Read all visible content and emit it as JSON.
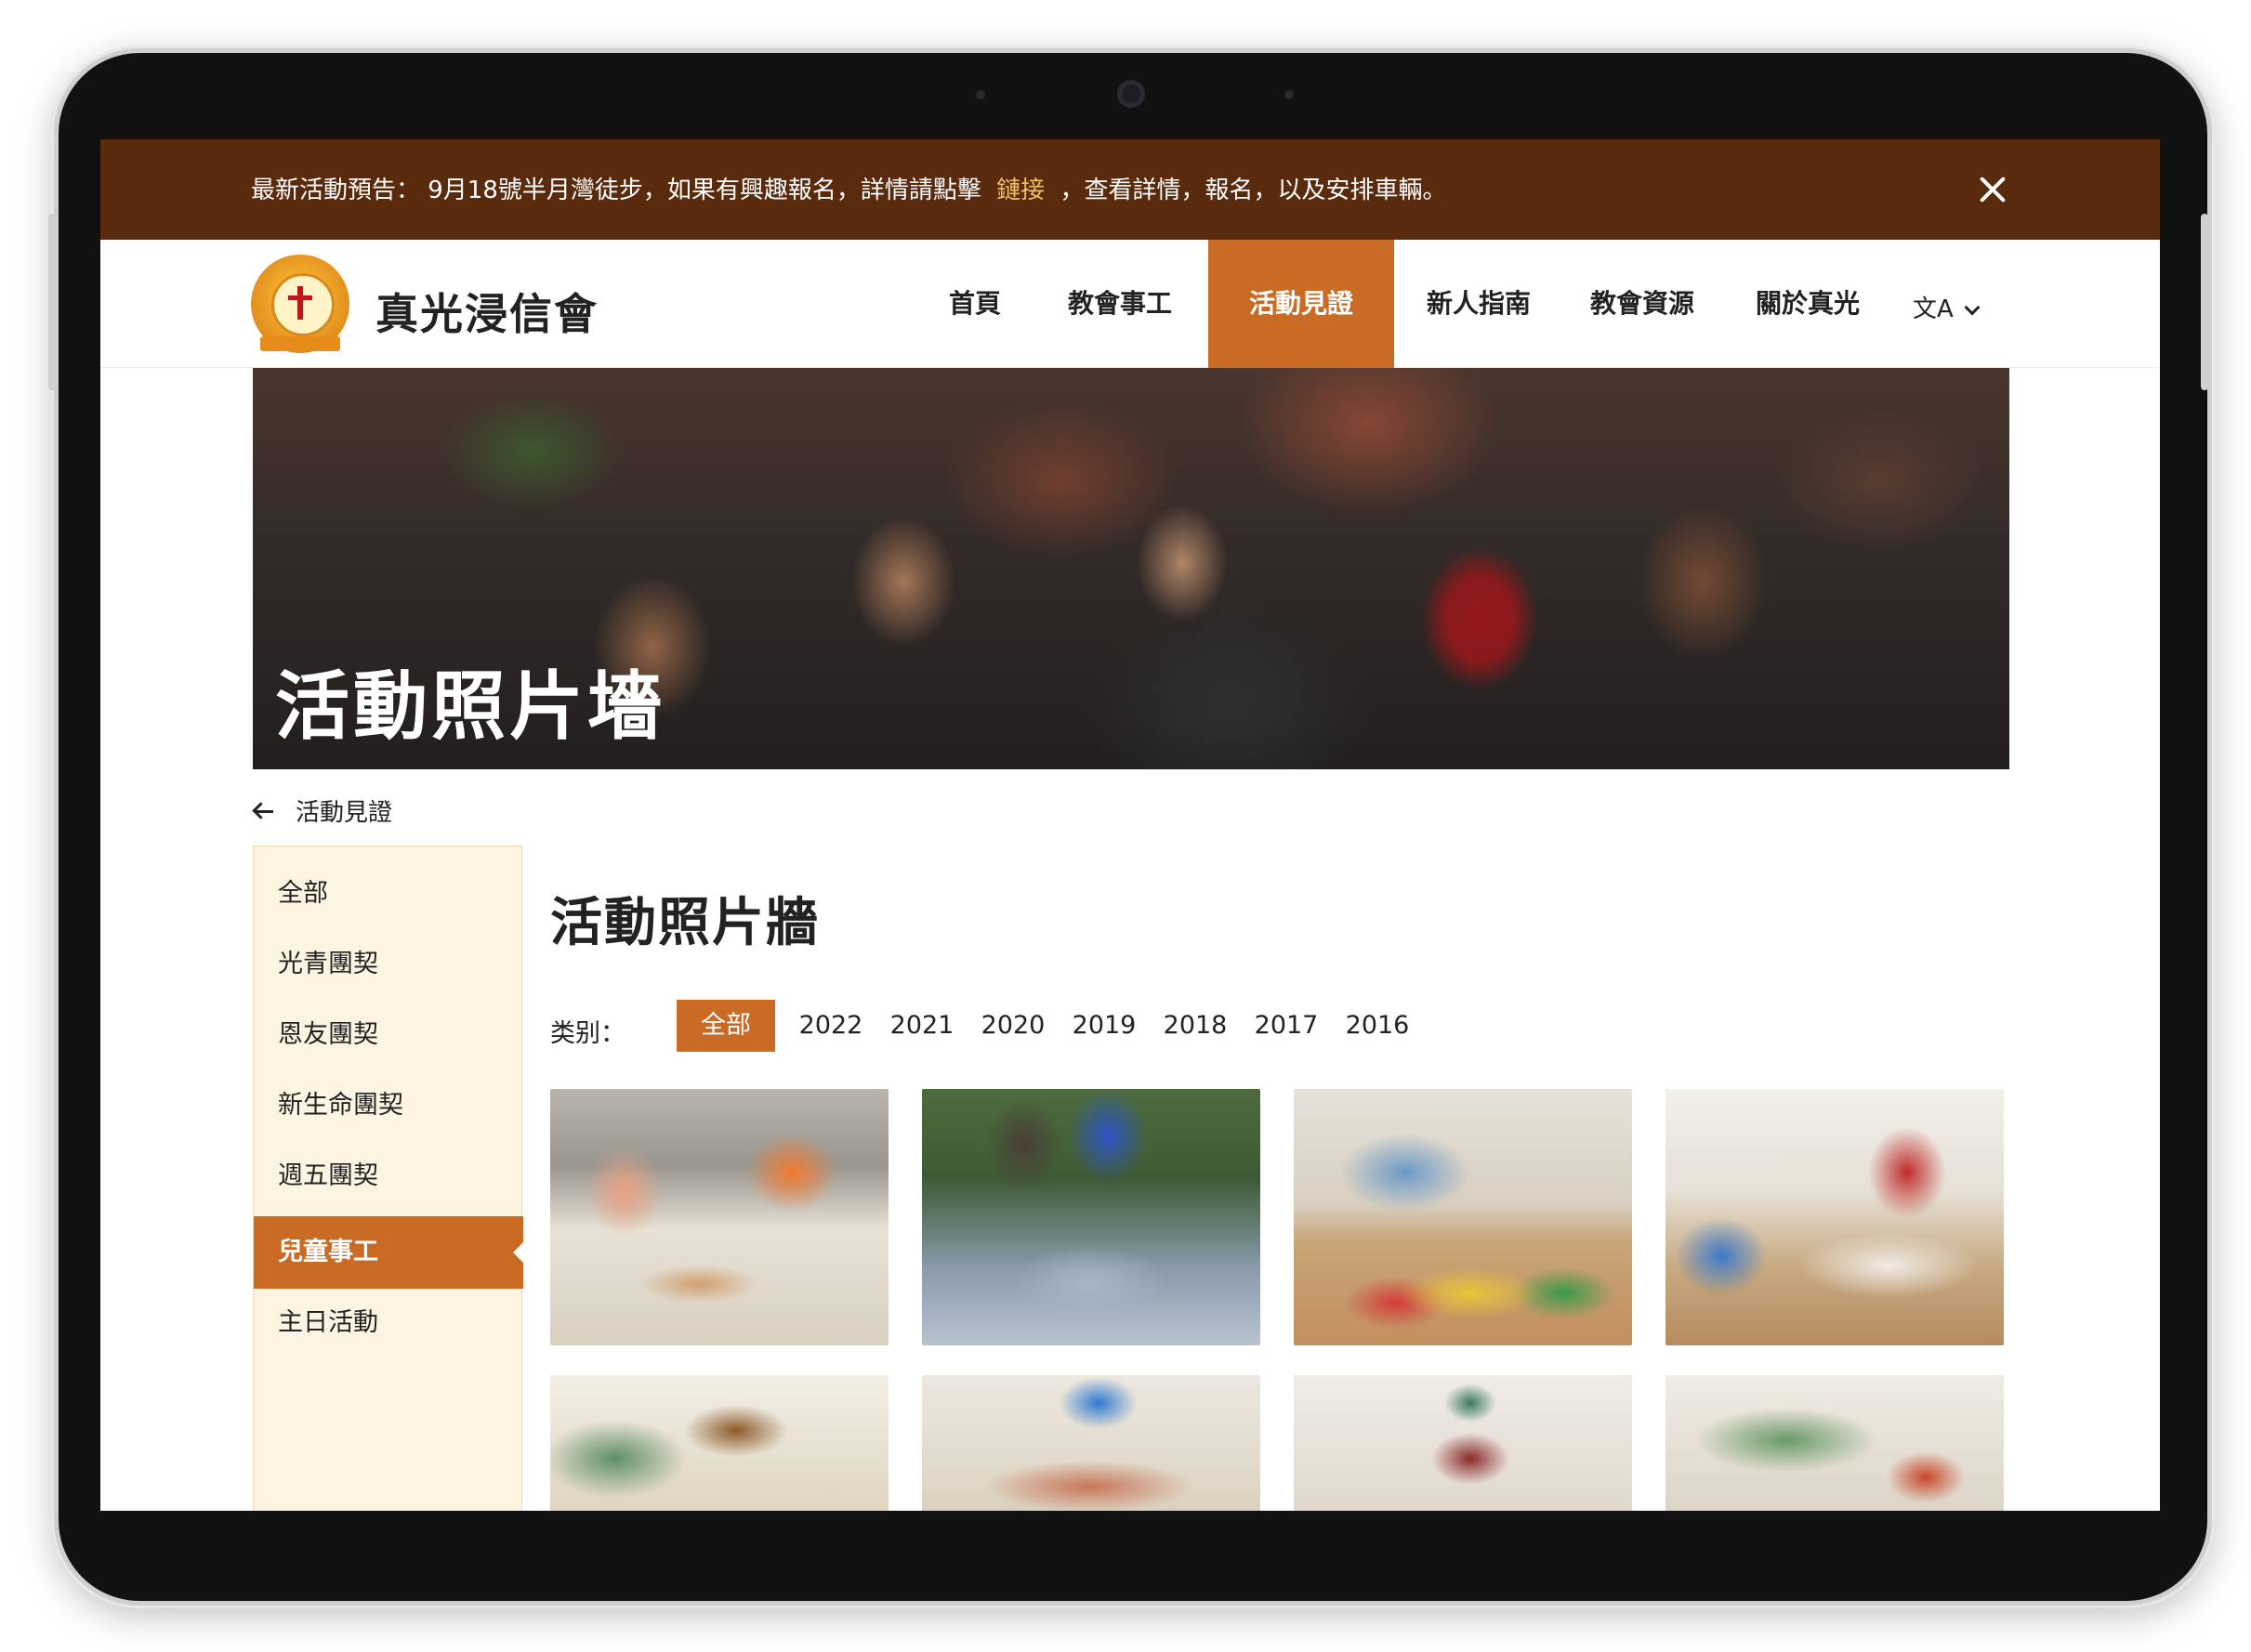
{
  "announcement": {
    "prefix": "最新活動預告： 9月18號半月灣徒步，如果有興趣報名，詳情請點擊",
    "link": "鏈接",
    "suffix": "，查看詳情，報名，以及安排車輛。",
    "close_icon": "close-icon"
  },
  "brand": {
    "name": "真光浸信會",
    "logo_icon": "church-logo-icon"
  },
  "nav": {
    "items": [
      {
        "label": "首頁"
      },
      {
        "label": "教會事工"
      },
      {
        "label": "活動見證"
      },
      {
        "label": "新人指南"
      },
      {
        "label": "教會資源"
      },
      {
        "label": "關於真光"
      }
    ],
    "active_index": 2,
    "language_label": "文A",
    "language_icon": "translate-icon",
    "accent_color": "#c96b24"
  },
  "hero": {
    "title": "活動照片墻"
  },
  "breadcrumb": {
    "label": "活動見證",
    "icon": "arrow-left-icon"
  },
  "sidebar": {
    "items": [
      {
        "label": "全部"
      },
      {
        "label": "光青團契"
      },
      {
        "label": "恩友團契"
      },
      {
        "label": "新生命團契"
      },
      {
        "label": "週五團契"
      },
      {
        "label": "兒童事工"
      },
      {
        "label": "主日活動"
      }
    ],
    "active_index": 5
  },
  "main": {
    "title": "活動照片牆",
    "filter_label": "类别：",
    "filters": [
      "全部",
      "2022",
      "2021",
      "2020",
      "2019",
      "2018",
      "2017",
      "2016"
    ],
    "active_filter_index": 0
  },
  "colors": {
    "announcement_bg": "#5a2a0d",
    "link": "#f0c060",
    "sidebar_bg": "#fdf4e2"
  }
}
